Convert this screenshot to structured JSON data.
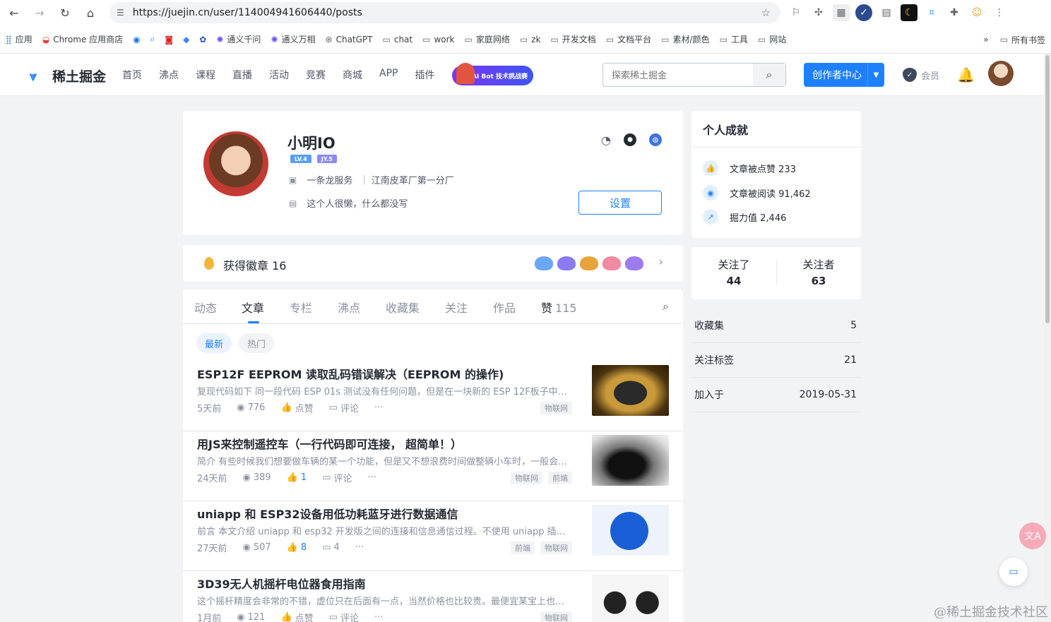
{
  "browser": {
    "url": "https://juejin.cn/user/114004941606440/posts",
    "bookmarks": [
      "应用",
      "Chrome 应用商店",
      "通义千问",
      "通义万相",
      "ChatGPT",
      "chat",
      "work",
      "家庭网络",
      "zk",
      "开发文档",
      "文档平台",
      "素材/颜色",
      "工具",
      "网站"
    ],
    "more_label": "»",
    "all_bookmarks": "所有书签"
  },
  "header": {
    "logo_text": "稀土掘金",
    "nav": [
      "首页",
      "沸点",
      "课程",
      "直播",
      "活动",
      "竞赛",
      "商城",
      "APP",
      "插件"
    ],
    "promo_text": "AI Bot 技术挑战赛",
    "search_placeholder": "探索稀土掘金",
    "creator_button": "创作者中心",
    "vip_label": "会员"
  },
  "profile": {
    "name": "小明IO",
    "level_badge": "LV.4",
    "jy_badge": "JY.5",
    "job": "一条龙服务",
    "company": "江南皮革厂第一分厂",
    "separator": "|",
    "bio": "这个人很懒，什么都没写",
    "settings_button": "设置"
  },
  "badges": {
    "label": "获得徽章 16"
  },
  "tabs": {
    "items": [
      "动态",
      "文章",
      "专栏",
      "沸点",
      "收藏集",
      "关注",
      "作品"
    ],
    "like_tab": "赞",
    "like_count": "115",
    "active": "文章"
  },
  "filters": [
    "最新",
    "热门"
  ],
  "articles": [
    {
      "title": "ESP12F EEPROM 读取乱码错误解决（EEPROM 的操作)",
      "brief": "复现代码如下 同一段代码 ESP 01s 测试没有任何问题，但是在一块新的 ESP 12F板子中出...",
      "time": "5天前",
      "views": "776",
      "likes": "点赞",
      "comments": "评论",
      "tags": [
        "物联网"
      ]
    },
    {
      "title": "用JS来控制遥控车（一行代码即可连接， 超简单！）",
      "brief": "简介 有些时候我们想要做车辆的某一个功能，但是又不想浪费时间做整辆小车时，一般会...",
      "time": "24天前",
      "views": "389",
      "likes": "1",
      "comments": "评论",
      "tags": [
        "物联网",
        "前端"
      ]
    },
    {
      "title": "uniapp 和 ESP32设备用低功耗蓝牙进行数据通信",
      "brief": "前言 本文介绍 uniapp 和 esp32 开发版之间的连接和信息通信过程。不使用 uniapp 插件...",
      "time": "27天前",
      "views": "507",
      "likes": "8",
      "comments": "4",
      "tags": [
        "前端",
        "物联网"
      ]
    },
    {
      "title": "3D39无人机摇杆电位器食用指南",
      "brief": "这个摇杆精度会非常的不错，虚位只在后面有一点，当然价格也比较贵。最便宜某宝上也得...",
      "time": "1月前",
      "views": "121",
      "likes": "点赞",
      "comments": "评论",
      "tags": [
        "物联网"
      ]
    }
  ],
  "achievements": {
    "title": "个人成就",
    "items": [
      {
        "label": "文章被点赞",
        "value": "233"
      },
      {
        "label": "文章被阅读",
        "value": "91,462"
      },
      {
        "label": "掘力值",
        "value": "2,446"
      }
    ]
  },
  "follow": {
    "following_label": "关注了",
    "following": "44",
    "followers_label": "关注者",
    "followers": "63"
  },
  "stats": [
    {
      "label": "收藏集",
      "value": "5"
    },
    {
      "label": "关注标签",
      "value": "21"
    },
    {
      "label": "加入于",
      "value": "2019-05-31"
    }
  ],
  "watermark": "@稀土掘金技术社区",
  "colors": {
    "brand": "#1e80ff",
    "text": "#252933",
    "muted": "#8a919f"
  }
}
